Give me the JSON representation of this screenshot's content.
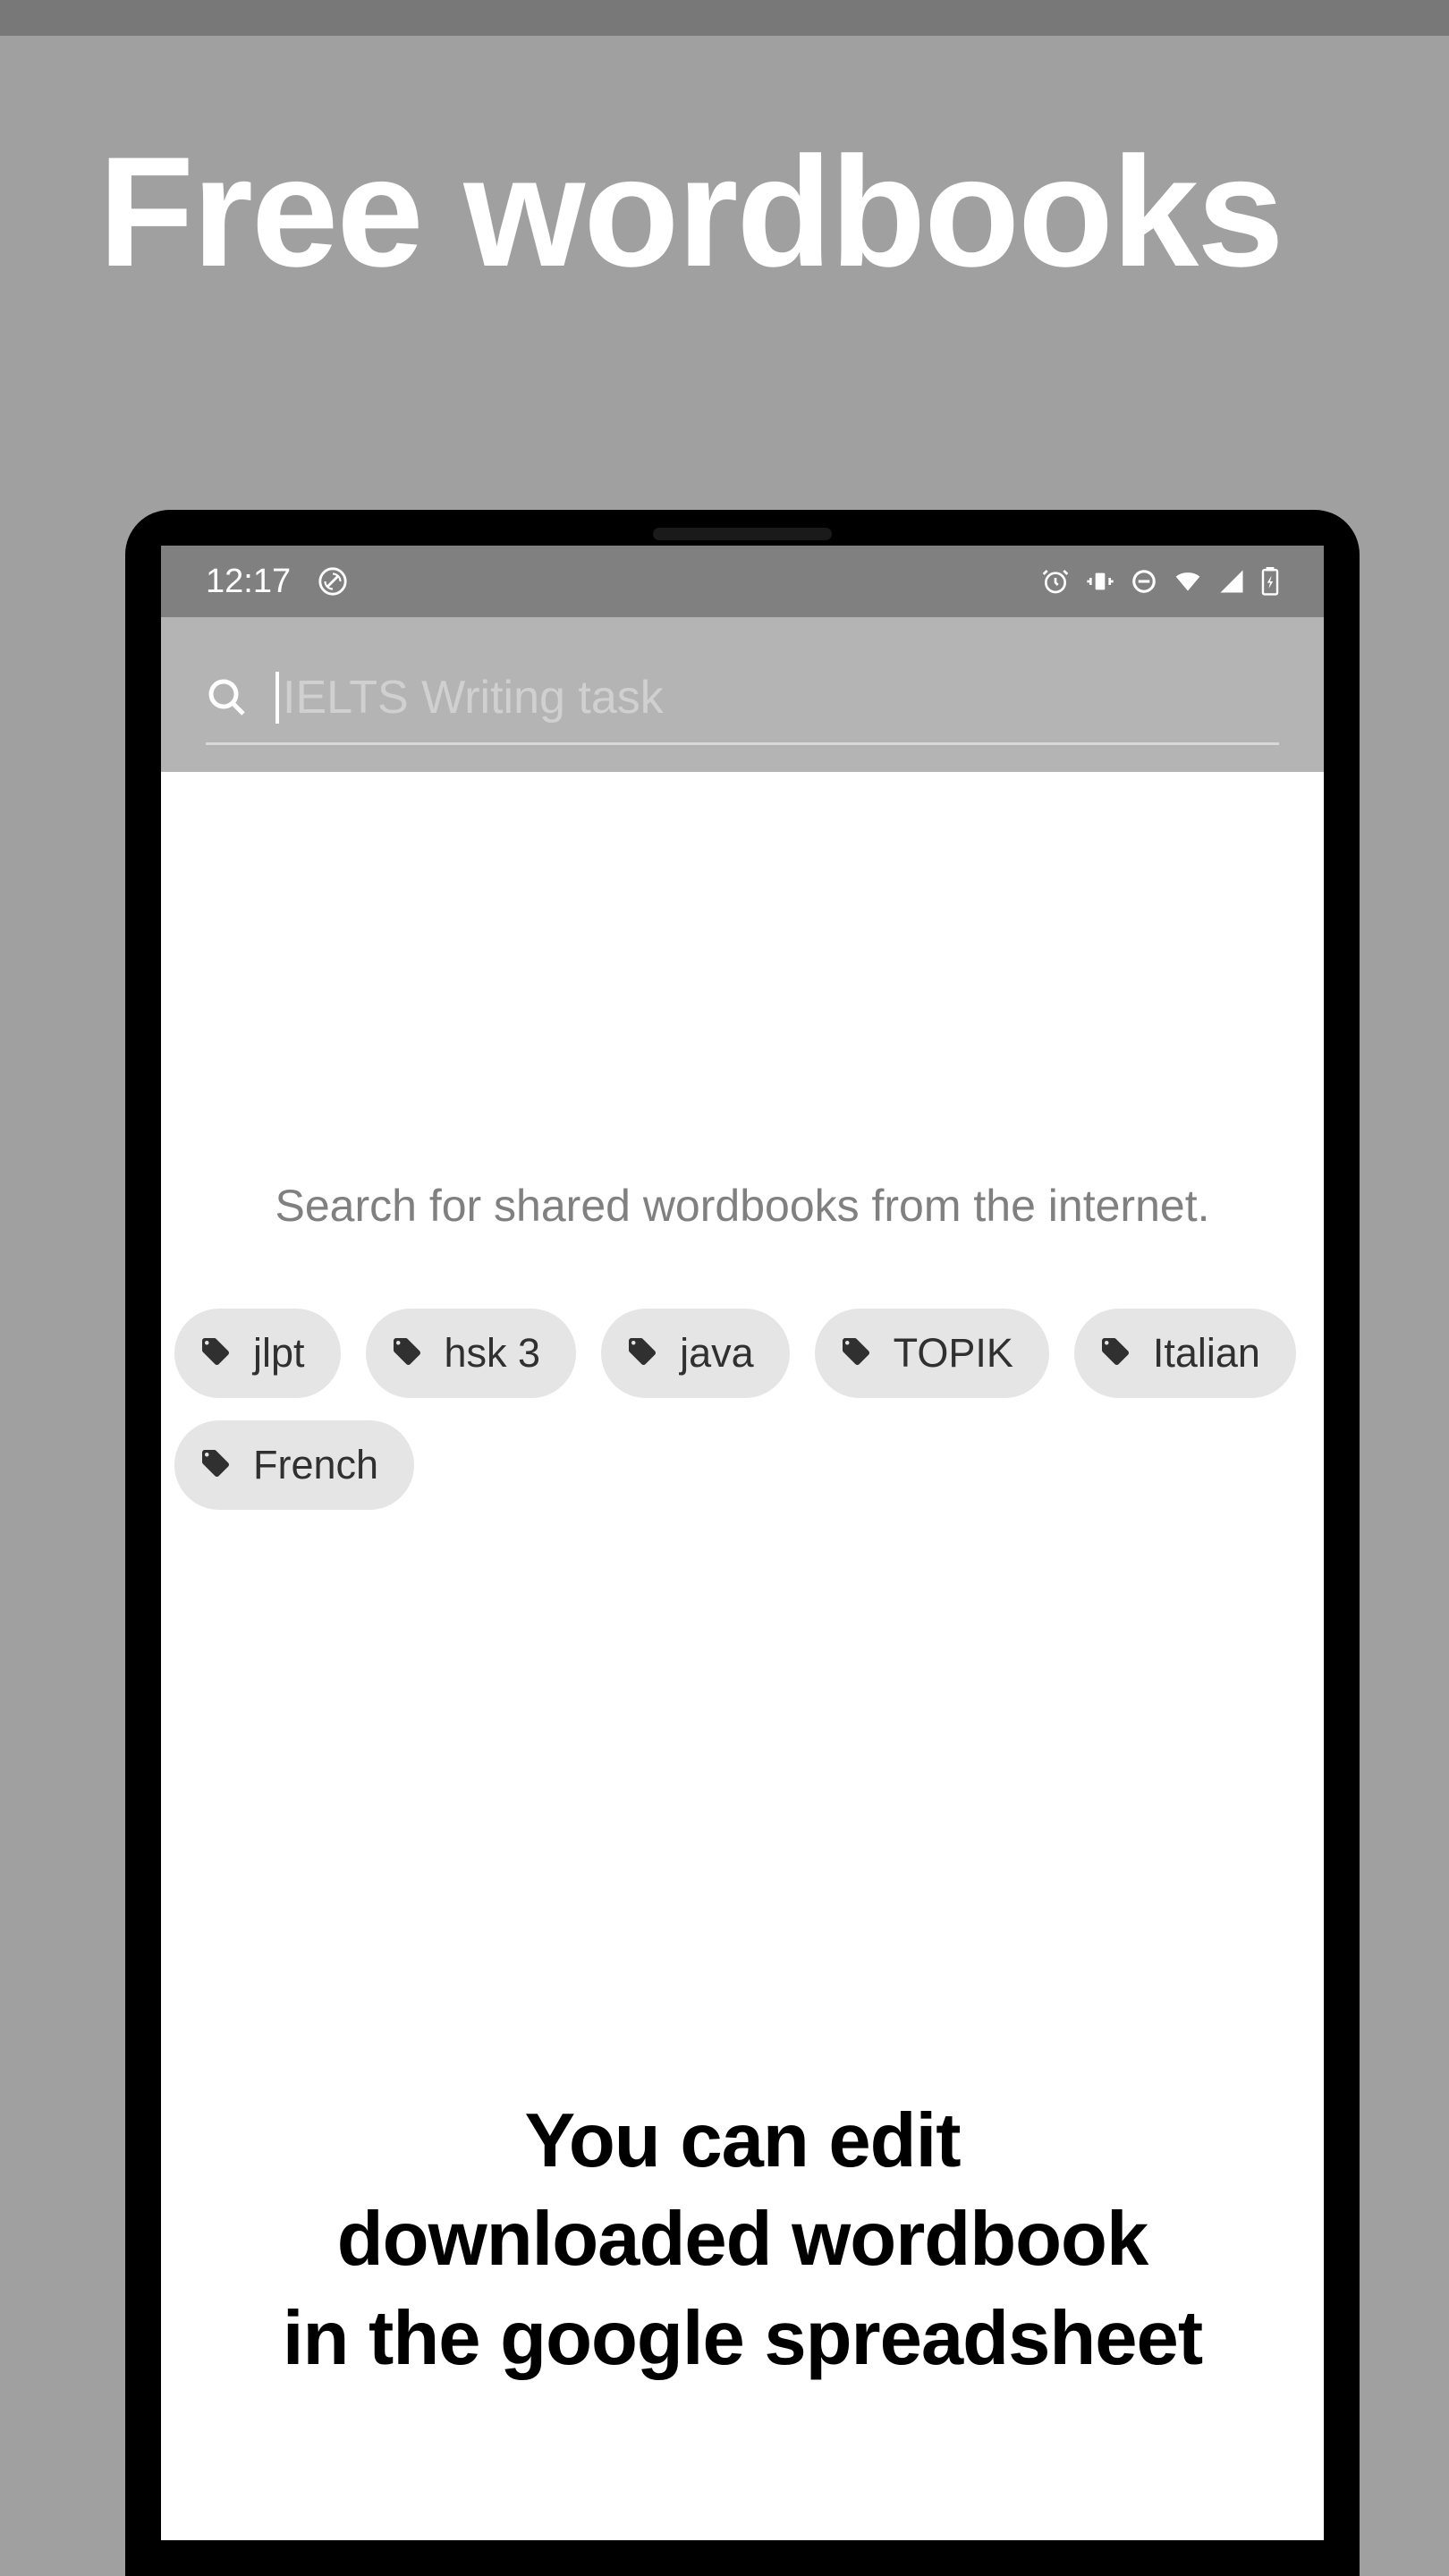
{
  "page": {
    "title": "Free wordbooks"
  },
  "statusBar": {
    "time": "12:17"
  },
  "search": {
    "placeholder": "IELTS Writing task"
  },
  "content": {
    "subtitle": "Search for shared wordbooks from the internet."
  },
  "chips": [
    {
      "label": "jlpt"
    },
    {
      "label": "hsk 3"
    },
    {
      "label": "java"
    },
    {
      "label": "TOPIK"
    },
    {
      "label": "Italian"
    },
    {
      "label": "French"
    }
  ],
  "promo": {
    "line1": "You can edit",
    "line2": "downloaded wordbook",
    "line3": "in the google spreadsheet"
  }
}
